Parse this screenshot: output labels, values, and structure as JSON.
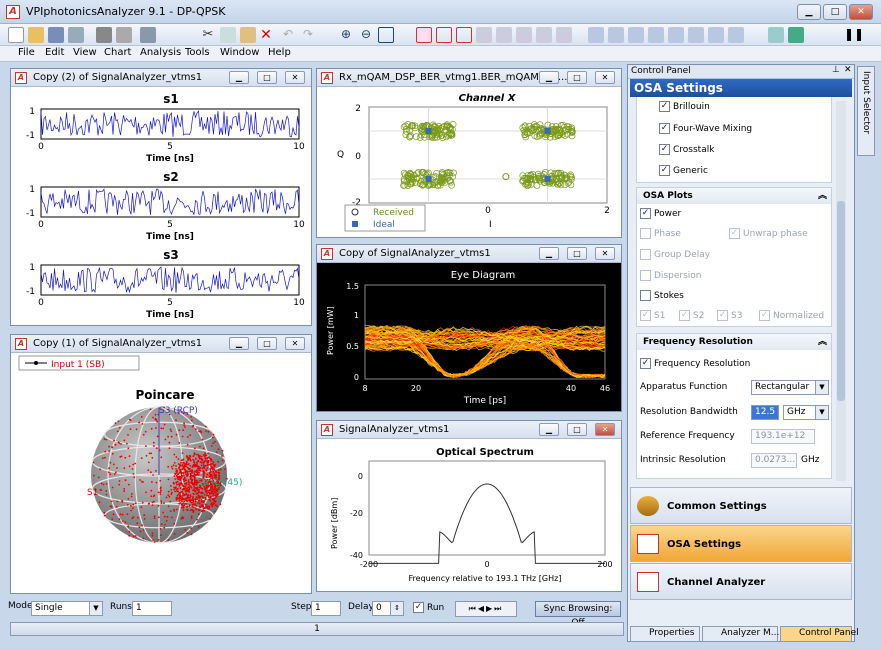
{
  "app": {
    "title": "VPIphotonicsAnalyzer 9.1 - DP-QPSK"
  },
  "menu": [
    "File",
    "Edit",
    "View",
    "Chart",
    "Analysis",
    "Tools",
    "Window",
    "Help"
  ],
  "panels": {
    "s_plots": {
      "title": "Copy (2) of SignalAnalyzer_vtms1",
      "plots": [
        {
          "title": "s1",
          "xlabel": "Time [ns]"
        },
        {
          "title": "s2",
          "xlabel": "Time [ns]"
        },
        {
          "title": "s3",
          "xlabel": "Time [ns]"
        }
      ],
      "xticks": [
        "0",
        "5",
        "10"
      ],
      "yticks": [
        "1",
        "-1"
      ]
    },
    "poincare": {
      "title": "Copy (1) of SignalAnalyzer_vtms1",
      "legend": "Input 1 (SB)",
      "chart_title": "Poincare",
      "s3_label": "S3 (RCP)",
      "s2_label": "S2 (L+45)",
      "s1_label": "S1"
    },
    "constellation": {
      "title": "Rx_mQAM_DSP_BER_vtmg1.BER_mQAM_DS...",
      "chart_title": "Channel X",
      "xlabel": "I",
      "ylabel": "Q",
      "legend_received": "Received",
      "legend_ideal": "Ideal",
      "xticks": [
        "-2",
        "0",
        "2"
      ],
      "yticks": [
        "2",
        "0",
        "-2"
      ]
    },
    "eye": {
      "title": "Copy of SignalAnalyzer_vtms1",
      "chart_title": "Eye Diagram",
      "xlabel": "Time [ps]",
      "ylabel": "Power [mW]",
      "xticks": [
        "8",
        "20",
        "40",
        "46"
      ],
      "yticks": [
        "1.5",
        "1",
        "0.5",
        "0"
      ]
    },
    "spectrum": {
      "title": "SignalAnalyzer_vtms1",
      "chart_title": "Optical Spectrum",
      "xlabel": "Frequency relative to 193.1 THz [GHz]",
      "ylabel": "Power [dBm]",
      "xticks": [
        "-200",
        "0",
        "200"
      ],
      "yticks": [
        "0",
        "-20",
        "-40"
      ]
    }
  },
  "control": {
    "header": "Control Panel",
    "banner": "OSA Settings",
    "side_tab": "Input Selector",
    "effects": [
      "Brillouin",
      "Four-Wave Mixing",
      "Crosstalk",
      "Generic"
    ],
    "osa_plots": {
      "title": "OSA Plots",
      "power": "Power",
      "phase": "Phase",
      "unwrap": "Unwrap phase",
      "group_delay": "Group Delay",
      "dispersion": "Dispersion",
      "stokes": "Stokes",
      "s1": "S1",
      "s2": "S2",
      "s3": "S3",
      "normalized": "Normalized"
    },
    "freq_res": {
      "title": "Frequency Resolution",
      "check": "Frequency Resolution",
      "apparatus_label": "Apparatus Function",
      "apparatus_value": "Rectangular",
      "bw_label": "Resolution Bandwidth",
      "bw_value": "12.5",
      "bw_unit": "GHz",
      "ref_label": "Reference Frequency",
      "ref_value": "193.1e+12",
      "intr_label": "Intrinsic Resolution",
      "intr_value": "0.0273...",
      "intr_unit": "GHz"
    },
    "nav": [
      "Common Settings",
      "OSA Settings",
      "Channel Analyzer"
    ],
    "tabs": [
      "Properties",
      "Analyzer M...",
      "Control Panel"
    ]
  },
  "bottom": {
    "mode_label": "Mode",
    "mode_value": "Single",
    "runs_label": "Runs",
    "runs_value": "1",
    "step_label": "Step",
    "step_value": "1",
    "delay_label": "Delay",
    "delay_value": "0",
    "run_label": "Run",
    "sync": "Sync Browsing: Off",
    "status": "1"
  }
}
